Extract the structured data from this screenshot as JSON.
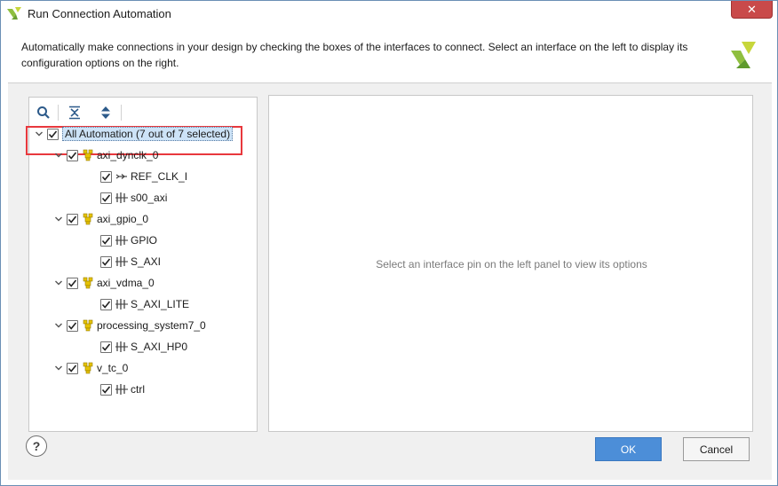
{
  "window": {
    "title": "Run Connection Automation",
    "close_label": "✕"
  },
  "header": {
    "description": "Automatically make connections in your design by checking the boxes of the interfaces to connect. Select an interface on the left to display its configuration options on the right."
  },
  "tree": {
    "root": {
      "label": "All Automation (7 out of 7 selected)",
      "checked": true,
      "expanded": true
    },
    "cells": [
      {
        "label": "axi_dynclk_0",
        "checked": true,
        "expanded": true,
        "children": [
          {
            "label": "REF_CLK_I",
            "checked": true,
            "icon": "clock-pin-icon"
          },
          {
            "label": "s00_axi",
            "checked": true,
            "icon": "bus-interface-icon"
          }
        ]
      },
      {
        "label": "axi_gpio_0",
        "checked": true,
        "expanded": true,
        "children": [
          {
            "label": "GPIO",
            "checked": true,
            "icon": "bus-interface-icon"
          },
          {
            "label": "S_AXI",
            "checked": true,
            "icon": "bus-interface-icon"
          }
        ]
      },
      {
        "label": "axi_vdma_0",
        "checked": true,
        "expanded": true,
        "children": [
          {
            "label": "S_AXI_LITE",
            "checked": true,
            "icon": "bus-interface-icon"
          }
        ]
      },
      {
        "label": "processing_system7_0",
        "checked": true,
        "expanded": true,
        "children": [
          {
            "label": "S_AXI_HP0",
            "checked": true,
            "icon": "bus-interface-icon"
          }
        ]
      },
      {
        "label": "v_tc_0",
        "checked": true,
        "expanded": true,
        "children": [
          {
            "label": "ctrl",
            "checked": true,
            "icon": "bus-interface-icon"
          }
        ]
      }
    ]
  },
  "right_panel": {
    "placeholder": "Select an interface pin on the left panel to view its options"
  },
  "buttons": {
    "help": "?",
    "ok": "OK",
    "cancel": "Cancel"
  },
  "colors": {
    "accent": "#4c8ed8",
    "highlight_box": "#e8383d",
    "cell_icon": "#e6c300",
    "selection": "#cde3f7"
  }
}
